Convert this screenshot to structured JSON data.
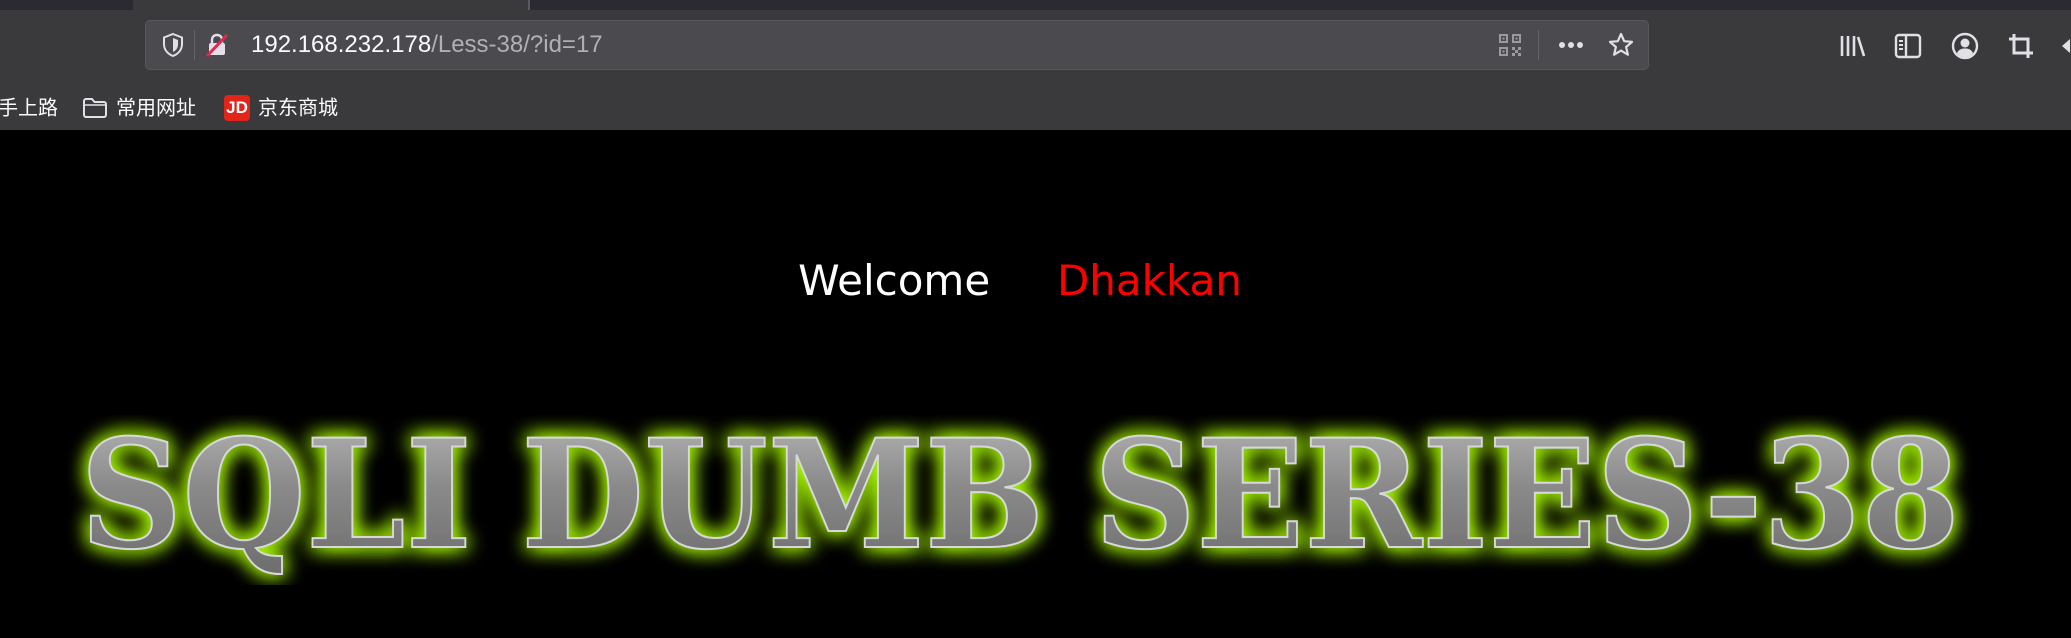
{
  "browser": {
    "url_host": "192.168.232.178",
    "url_path": "/Less-38/?id=17",
    "icons": {
      "tracking": "shield-icon",
      "insecure": "insecure-lock-icon",
      "qr": "qr-code-icon",
      "page_actions": "more-actions-icon",
      "bookmark": "star-icon",
      "library": "library-icon",
      "sidebar": "sidebar-icon",
      "account": "account-icon",
      "screenshot": "crop-icon"
    }
  },
  "bookmarks": {
    "items": [
      {
        "label": "手上路",
        "icon": "none"
      },
      {
        "label": "常用网址",
        "icon": "folder-icon"
      },
      {
        "label": "京东商城",
        "icon": "jd-icon",
        "icon_text": "JD"
      }
    ]
  },
  "page": {
    "welcome": "Welcome",
    "name": "Dhakkan",
    "banner_text": "SQLI DUMB SERIES-38",
    "colors": {
      "background": "#000000",
      "welcome": "#ffffff",
      "name": "#ff0000",
      "banner_glow": "#a6f50a",
      "banner_fill": "#8e8e8e"
    }
  }
}
